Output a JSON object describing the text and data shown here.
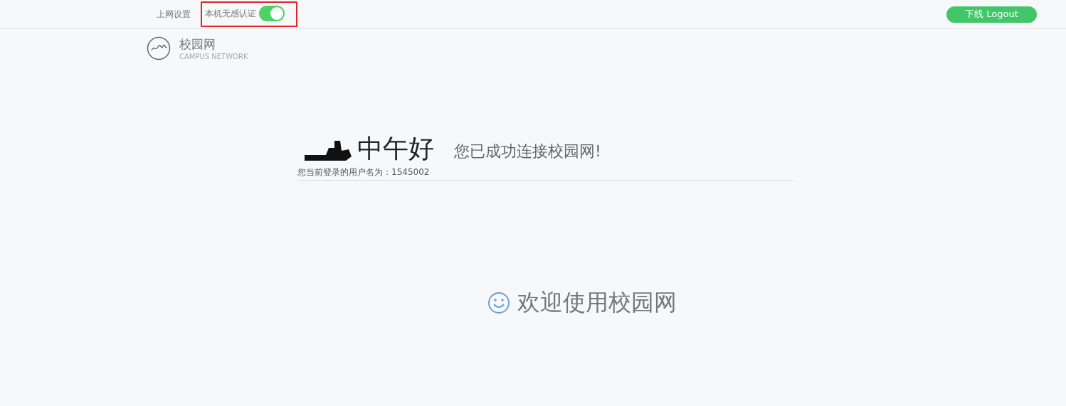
{
  "top_bar": {
    "settings_link": "上网设置",
    "toggle": {
      "label": "本机无感认证",
      "on": true,
      "highlighted": true
    },
    "logout_button": "下线 Logout"
  },
  "brand": {
    "name": "校园网",
    "subtitle": "CAMPUS NETWORK"
  },
  "greeting": {
    "salutation": "中午好",
    "message": "您已成功连接校园网!",
    "username_line": "您当前登录的用户名为：1545002"
  },
  "welcome": "欢迎使用校园网"
}
